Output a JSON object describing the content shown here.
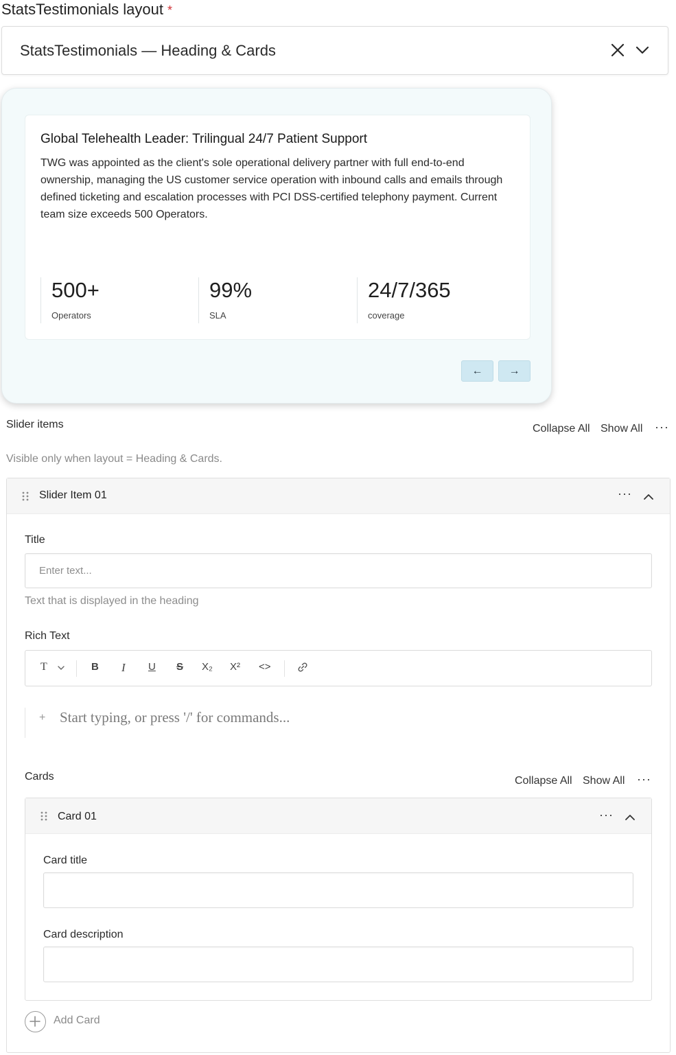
{
  "layout_field": {
    "label": "StatsTestimonials layout",
    "required_mark": "*",
    "value": "StatsTestimonials — Heading & Cards"
  },
  "preview": {
    "heading": "Global Telehealth Leader: Trilingual 24/7 Patient Support",
    "body": "TWG was appointed as the client's sole operational delivery partner with full end-to-end ownership, managing the US customer service operation with inbound calls and emails through defined ticketing and escalation processes with PCI DSS-certified telephony payment. Current team size exceeds 500 Operators.",
    "stats": [
      {
        "value": "500+",
        "label": "Operators"
      },
      {
        "value": "99%",
        "label": "SLA"
      },
      {
        "value": "24/7/365",
        "label": "coverage"
      }
    ],
    "prev_label": "←",
    "next_label": "→"
  },
  "slider_items": {
    "label": "Slider items",
    "collapse_all": "Collapse All",
    "show_all": "Show All",
    "more": "···",
    "hint": "Visible only when layout = Heading & Cards.",
    "item": {
      "title": "Slider Item 01",
      "title_field": {
        "label": "Title",
        "placeholder": "Enter text...",
        "help": "Text that is displayed in the heading"
      },
      "rich_text": {
        "label": "Rich Text",
        "toolbar": {
          "text_style": "T",
          "bold": "B",
          "italic": "I",
          "underline": "U",
          "strike": "S",
          "subscript": "X₂",
          "superscript": "X²",
          "code": "<>"
        },
        "placeholder": "Start typing, or press '/' for commands..."
      },
      "cards": {
        "label": "Cards",
        "collapse_all": "Collapse All",
        "show_all": "Show All",
        "more": "···",
        "card": {
          "title": "Card 01",
          "card_title_label": "Card title",
          "card_title_value": "",
          "card_description_label": "Card description",
          "card_description_value": ""
        },
        "add_label": "Add Card"
      }
    }
  }
}
